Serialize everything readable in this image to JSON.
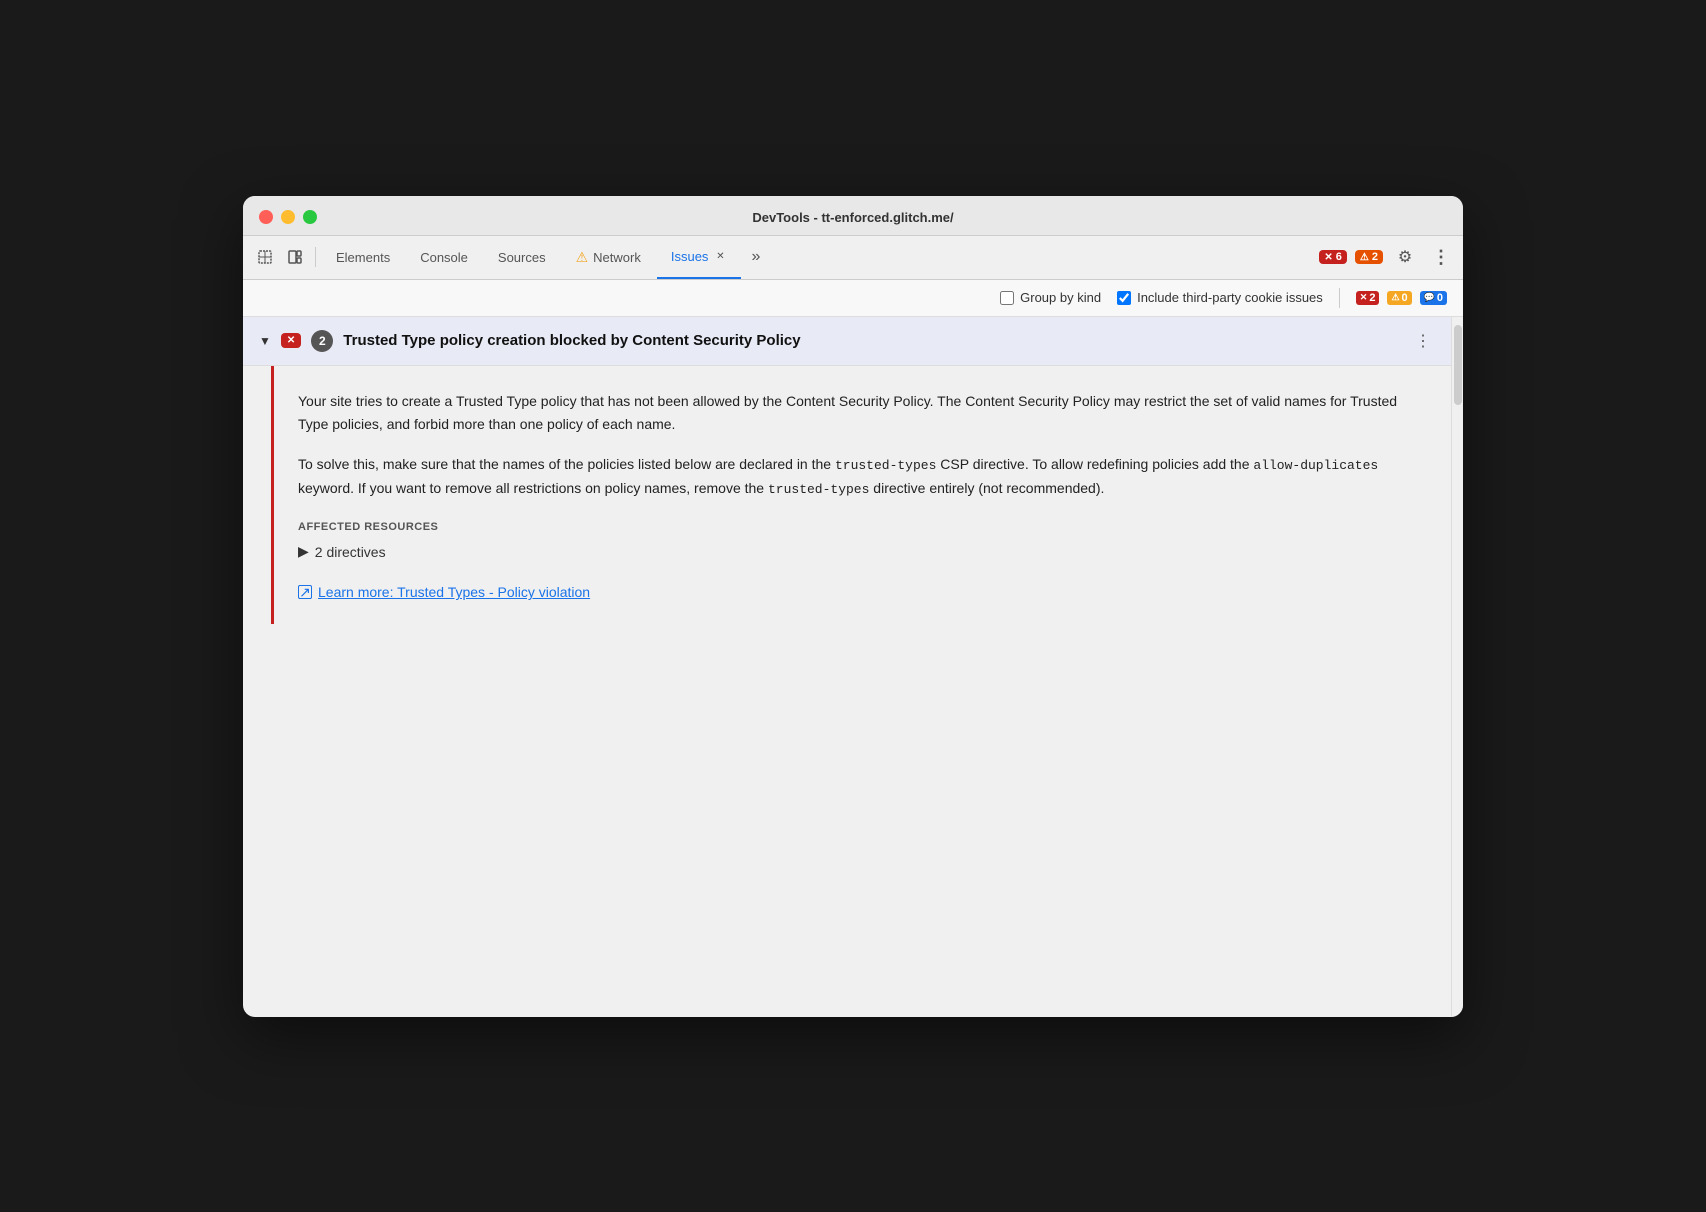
{
  "window": {
    "title": "DevTools - tt-enforced.glitch.me/"
  },
  "toolbar": {
    "elements_label": "Elements",
    "console_label": "Console",
    "sources_label": "Sources",
    "network_label": "Network",
    "issues_label": "Issues",
    "error_count": "6",
    "warning_count": "2",
    "more_tabs_label": ">>"
  },
  "secondary_toolbar": {
    "group_by_kind_label": "Group by kind",
    "include_third_party_label": "Include third-party cookie issues",
    "error_badge_count": "2",
    "warning_badge_count": "0",
    "info_badge_count": "0"
  },
  "issue": {
    "title": "Trusted Type policy creation blocked by Content Security Policy",
    "count": "2",
    "description_p1": "Your site tries to create a Trusted Type policy that has not been allowed by the Content Security Policy. The Content Security Policy may restrict the set of valid names for Trusted Type policies, and forbid more than one policy of each name.",
    "description_p2_pre": "To solve this, make sure that the names of the policies listed below are declared in the ",
    "description_p2_code1": "trusted-types",
    "description_p2_mid": " CSP directive. To allow redefining policies add the ",
    "description_p2_code2": "allow-duplicates",
    "description_p2_post": " keyword. If you want to remove all restrictions on policy names, remove the ",
    "description_p2_code3": "trusted-types",
    "description_p2_end": " directive entirely (not recommended).",
    "affected_resources_title": "AFFECTED RESOURCES",
    "affected_item": "2 directives",
    "learn_more_text": "Learn more: Trusted Types - Policy violation"
  },
  "icons": {
    "cursor": "⬚",
    "inspector": "▣",
    "chevron_down": "▼",
    "chevron_right": "▶",
    "close": "✕",
    "more_tabs": "»",
    "settings": "⚙",
    "more_vert": "⋮",
    "warning": "⚠",
    "external_link": "↗",
    "error_x": "✕"
  }
}
